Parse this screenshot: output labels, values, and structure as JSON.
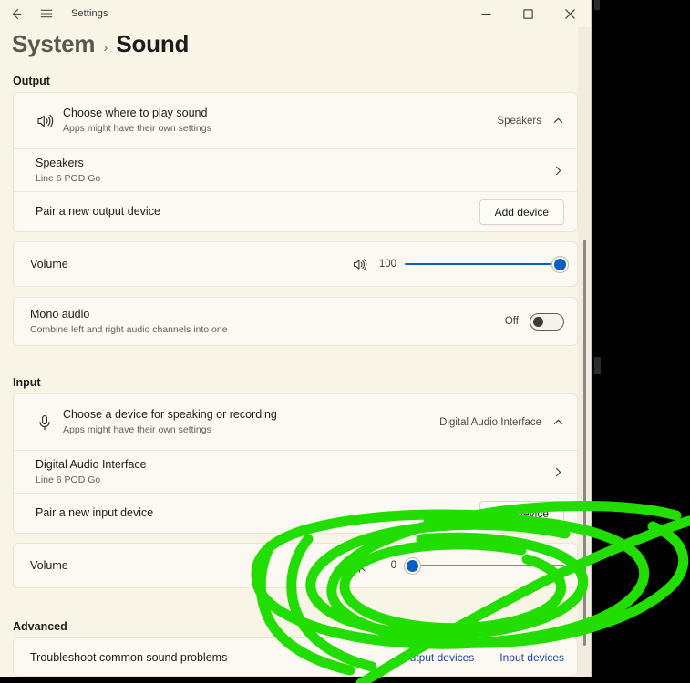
{
  "window": {
    "app_title": "Settings",
    "back_icon": "back-arrow-icon",
    "menu_icon": "hamburger-menu-icon",
    "minimize_label": "Minimize",
    "maximize_label": "Maximize",
    "close_label": "Close"
  },
  "breadcrumb": {
    "parent": "System",
    "separator": "›",
    "current": "Sound"
  },
  "sections": {
    "output_title": "Output",
    "input_title": "Input",
    "advanced_title": "Advanced"
  },
  "output": {
    "choose": {
      "icon": "speaker-icon",
      "title": "Choose where to play sound",
      "subtitle": "Apps might have their own settings",
      "value": "Speakers",
      "expand_icon": "chevron-up-icon"
    },
    "device": {
      "title": "Speakers",
      "subtitle": "Line 6 POD Go",
      "chevron_icon": "chevron-right-icon"
    },
    "pair": {
      "title": "Pair a new output device",
      "button": "Add device"
    },
    "volume": {
      "title": "Volume",
      "icon": "speaker-icon",
      "value": "100",
      "percent": 100
    },
    "mono": {
      "title": "Mono audio",
      "subtitle": "Combine left and right audio channels into one",
      "state": "Off"
    }
  },
  "input": {
    "choose": {
      "icon": "microphone-icon",
      "title": "Choose a device for speaking or recording",
      "subtitle": "Apps might have their own settings",
      "value": "Digital Audio Interface",
      "expand_icon": "chevron-up-icon"
    },
    "device": {
      "title": "Digital Audio Interface",
      "subtitle": "Line 6 POD Go",
      "chevron_icon": "chevron-right-icon"
    },
    "pair": {
      "title": "Pair a new input device",
      "button": "Add device"
    },
    "volume": {
      "title": "Volume",
      "icon": "microphone-muted-icon",
      "value": "0",
      "percent": 0
    }
  },
  "advanced": {
    "troubleshoot": "Troubleshoot common sound problems",
    "link_output": "Output devices",
    "link_input": "Input devices"
  },
  "annotation": {
    "tool": "green-scribble-highlight",
    "color": "#22dd00"
  },
  "colors": {
    "page_background": "#f8f4e6",
    "card_background": "#fbf9f2",
    "accent": "#0a5fc2",
    "link": "#1a43a8",
    "annotation_green": "#22dd00"
  }
}
